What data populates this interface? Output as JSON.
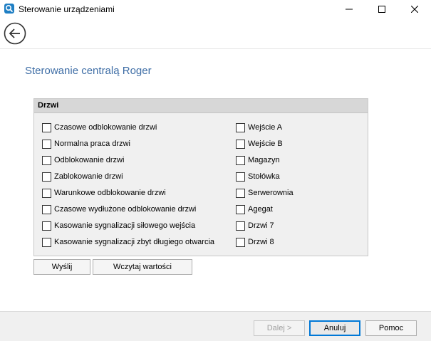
{
  "window": {
    "title": "Sterowanie urządzeniami",
    "app_icon": "app-logo-icon",
    "controls": [
      "minimize-icon",
      "maximize-icon",
      "close-icon"
    ]
  },
  "nav": {
    "back_icon": "back-arrow-icon"
  },
  "page": {
    "heading": "Sterowanie centralą Roger"
  },
  "group": {
    "title": "Drzwi",
    "left_options": [
      {
        "label": "Czasowe odblokowanie drzwi",
        "checked": false
      },
      {
        "label": "Normalna praca drzwi",
        "checked": false
      },
      {
        "label": "Odblokowanie drzwi",
        "checked": false
      },
      {
        "label": "Zablokowanie drzwi",
        "checked": false
      },
      {
        "label": "Warunkowe odblokowanie drzwi",
        "checked": false
      },
      {
        "label": "Czasowe wydłużone odblokowanie drzwi",
        "checked": false
      },
      {
        "label": "Kasowanie sygnalizacji siłowego wejścia",
        "checked": false
      },
      {
        "label": "Kasowanie sygnalizacji zbyt długiego otwarcia",
        "checked": false
      }
    ],
    "right_options": [
      {
        "label": "Wejście A",
        "checked": false
      },
      {
        "label": "Wejście B",
        "checked": false
      },
      {
        "label": "Magazyn",
        "checked": false
      },
      {
        "label": "Stołówka",
        "checked": false
      },
      {
        "label": "Serwerownia",
        "checked": false
      },
      {
        "label": "Agegat",
        "checked": false
      },
      {
        "label": "Drzwi 7",
        "checked": false
      },
      {
        "label": "Drzwi 8",
        "checked": false
      }
    ]
  },
  "actions": {
    "send": "Wyślij",
    "load": "Wczytaj wartości"
  },
  "footer": {
    "next": "Dalej >",
    "cancel": "Anuluj",
    "help": "Pomoc"
  },
  "colors": {
    "heading": "#3f6ea6",
    "focus_border": "#0078d7",
    "group_header": "#d7d7d7"
  }
}
